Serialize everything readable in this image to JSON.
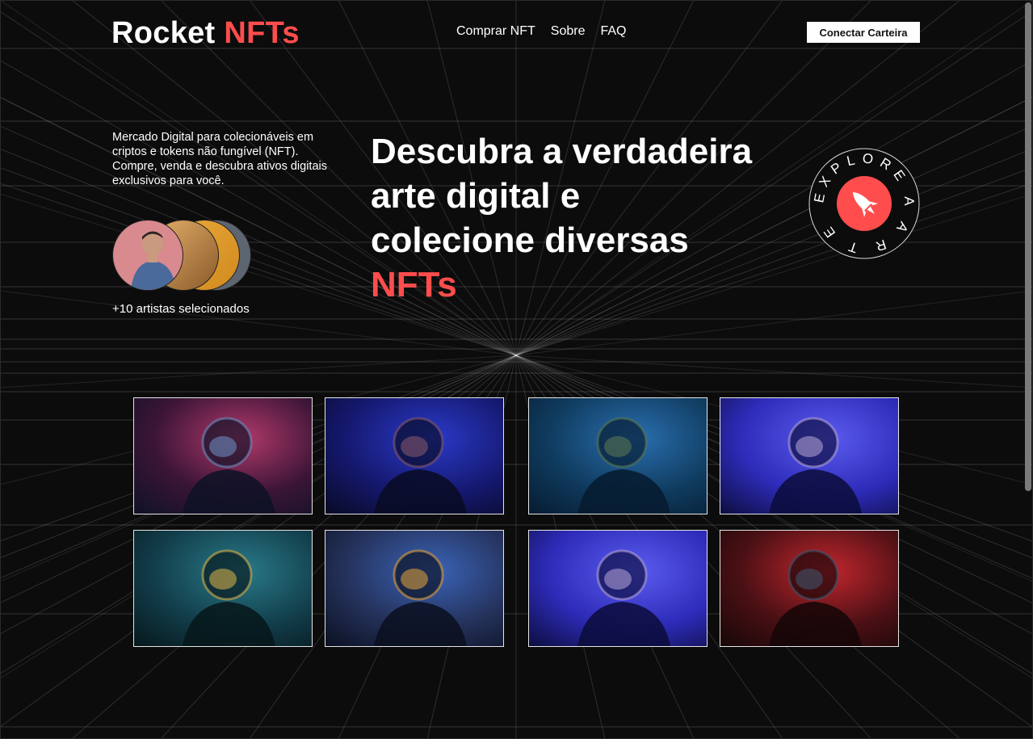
{
  "brand": {
    "name": "Rocket",
    "accent": "NFTs",
    "accent_color": "#ff4d4d"
  },
  "nav": {
    "items": [
      "Comprar NFT",
      "Sobre",
      "FAQ"
    ]
  },
  "connect_button": "Conectar Carteira",
  "intro": "Mercado Digital para colecionáveis em criptos e tokens não fungível (NFT). Compre, venda e descubra ativos digitais exclusivos para você.",
  "artists_label": "+10 artistas selecionados",
  "hero": {
    "line1": "Descubra a verdadeira",
    "line2": "arte digital e",
    "line3": "colecione diversas",
    "accent": "NFTs"
  },
  "badge": {
    "text": "EXPLORE A ARTE",
    "icon": "rocket-icon"
  },
  "gallery": [
    {
      "icon": "astronaut-image",
      "tone": "red-blue"
    },
    {
      "icon": "astronaut-image",
      "tone": "blue"
    },
    {
      "icon": "astronaut-image",
      "tone": "blue-green"
    },
    {
      "icon": "astronaut-image",
      "tone": "violet"
    },
    {
      "icon": "astronaut-image",
      "tone": "teal-gold"
    },
    {
      "icon": "astronaut-image",
      "tone": "gold"
    },
    {
      "icon": "astronaut-image",
      "tone": "violet"
    },
    {
      "icon": "astronaut-image",
      "tone": "red"
    }
  ]
}
